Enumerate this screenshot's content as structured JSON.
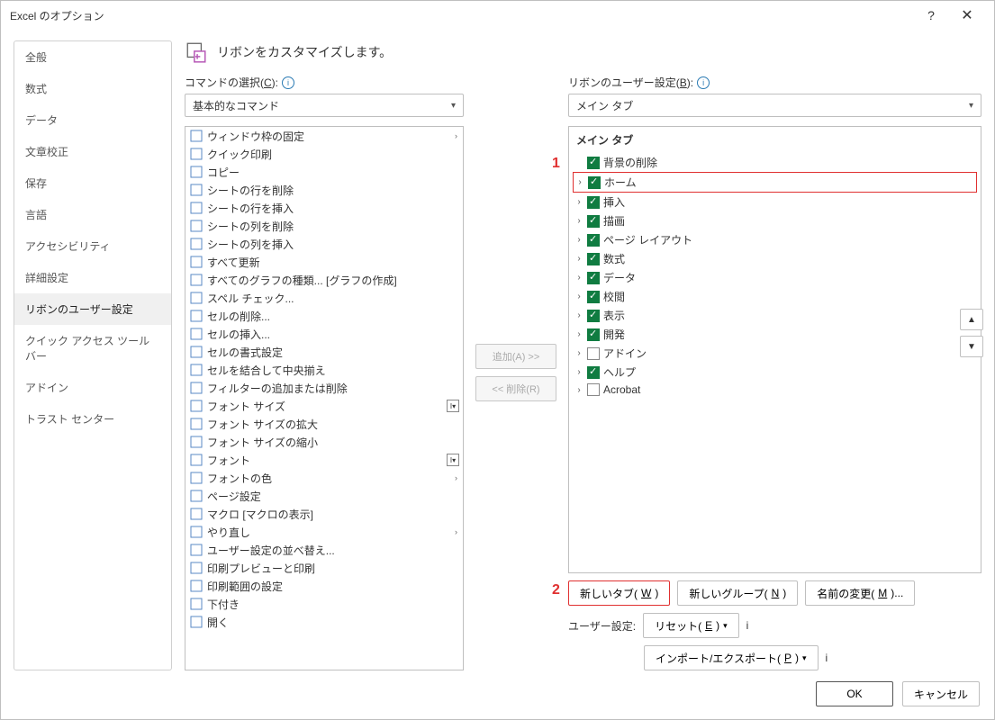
{
  "title": "Excel のオプション",
  "sidebar": {
    "items": [
      {
        "label": "全般"
      },
      {
        "label": "数式"
      },
      {
        "label": "データ"
      },
      {
        "label": "文章校正"
      },
      {
        "label": "保存"
      },
      {
        "label": "言語"
      },
      {
        "label": "アクセシビリティ"
      },
      {
        "label": "詳細設定"
      },
      {
        "label": "リボンのユーザー設定"
      },
      {
        "label": "クイック アクセス ツール バー"
      },
      {
        "label": "アドイン"
      },
      {
        "label": "トラスト センター"
      }
    ],
    "selected_index": 8
  },
  "header": {
    "text": "リボンをカスタマイズします。"
  },
  "left_panel": {
    "label_prefix": "コマンドの選択(",
    "label_accel": "C",
    "label_suffix": "):",
    "combo_value": "基本的なコマンド",
    "commands": [
      {
        "label": "ウィンドウ枠の固定",
        "chevron": true
      },
      {
        "label": "クイック印刷"
      },
      {
        "label": "コピー"
      },
      {
        "label": "シートの行を削除"
      },
      {
        "label": "シートの行を挿入"
      },
      {
        "label": "シートの列を削除"
      },
      {
        "label": "シートの列を挿入"
      },
      {
        "label": "すべて更新"
      },
      {
        "label": "すべてのグラフの種類... [グラフの作成]"
      },
      {
        "label": "スペル チェック..."
      },
      {
        "label": "セルの削除..."
      },
      {
        "label": "セルの挿入..."
      },
      {
        "label": "セルの書式設定"
      },
      {
        "label": "セルを結合して中央揃え"
      },
      {
        "label": "フィルターの追加または削除"
      },
      {
        "label": "フォント サイズ",
        "dropdown": true
      },
      {
        "label": "フォント サイズの拡大"
      },
      {
        "label": "フォント サイズの縮小"
      },
      {
        "label": "フォント",
        "dropdown": true
      },
      {
        "label": "フォントの色",
        "chevron": true
      },
      {
        "label": "ページ設定"
      },
      {
        "label": "マクロ [マクロの表示]"
      },
      {
        "label": "やり直し",
        "chevron": true
      },
      {
        "label": "ユーザー設定の並べ替え..."
      },
      {
        "label": "印刷プレビューと印刷"
      },
      {
        "label": "印刷範囲の設定"
      },
      {
        "label": "下付き"
      },
      {
        "label": "開く"
      }
    ]
  },
  "mid_buttons": {
    "add": "追加(A) >>",
    "remove": "<< 削除(R)"
  },
  "right_panel": {
    "label_prefix": "リボンのユーザー設定(",
    "label_accel": "B",
    "label_suffix": "):",
    "combo_value": "メイン タブ",
    "tree_header": "メイン タブ",
    "items": [
      {
        "label": "背景の削除",
        "checked": true,
        "expandable": false
      },
      {
        "label": "ホーム",
        "checked": true,
        "expandable": true,
        "highlight": true
      },
      {
        "label": "挿入",
        "checked": true,
        "expandable": true
      },
      {
        "label": "描画",
        "checked": true,
        "expandable": true
      },
      {
        "label": "ページ レイアウト",
        "checked": true,
        "expandable": true
      },
      {
        "label": "数式",
        "checked": true,
        "expandable": true
      },
      {
        "label": "データ",
        "checked": true,
        "expandable": true
      },
      {
        "label": "校閲",
        "checked": true,
        "expandable": true
      },
      {
        "label": "表示",
        "checked": true,
        "expandable": true
      },
      {
        "label": "開発",
        "checked": true,
        "expandable": true
      },
      {
        "label": "アドイン",
        "checked": false,
        "expandable": true
      },
      {
        "label": "ヘルプ",
        "checked": true,
        "expandable": true
      },
      {
        "label": "Acrobat",
        "checked": false,
        "expandable": true
      }
    ]
  },
  "below": {
    "new_tab_prefix": "新しいタブ(",
    "new_tab_accel": "W",
    "new_tab_suffix": ")",
    "new_group_prefix": "新しいグループ(",
    "new_group_accel": "N",
    "new_group_suffix": ")",
    "rename_prefix": "名前の変更(",
    "rename_accel": "M",
    "rename_suffix": ")...",
    "user_settings_label": "ユーザー設定:",
    "reset_prefix": "リセット(",
    "reset_accel": "E",
    "reset_suffix": ")",
    "import_prefix": "インポート/エクスポート(",
    "import_accel": "P",
    "import_suffix": ")"
  },
  "annotations": {
    "one": "1",
    "two": "2"
  },
  "footer": {
    "ok": "OK",
    "cancel": "キャンセル"
  }
}
